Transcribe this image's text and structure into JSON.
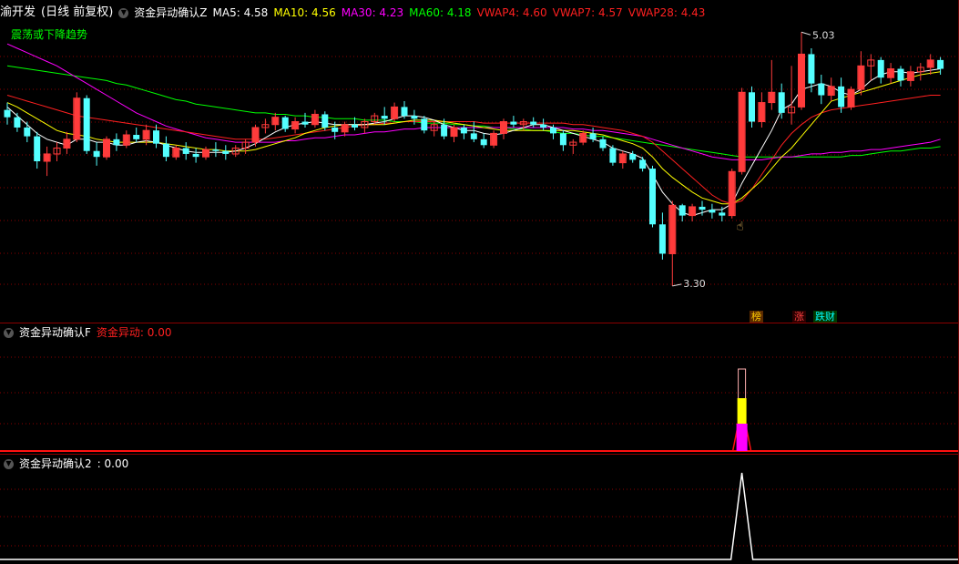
{
  "header": {
    "stock_name": "渝开发",
    "period": "(日线 前复权)",
    "indicator_main": "资金异动确认Z",
    "ma": [
      {
        "label": "MA5: 4.58",
        "color": "#ffffff"
      },
      {
        "label": "MA10: 4.56",
        "color": "#ffff00"
      },
      {
        "label": "MA30: 4.23",
        "color": "#ff00ff"
      },
      {
        "label": "MA60: 4.18",
        "color": "#00ff00"
      },
      {
        "label": "VWAP4: 4.60",
        "color": "#ff2020"
      },
      {
        "label": "VWAP7: 4.57",
        "color": "#ff2020"
      },
      {
        "label": "VWAP28: 4.43",
        "color": "#ff2020"
      }
    ],
    "trend_text": "震荡或下降趋势",
    "high_label": "5.03",
    "low_label": "3.30"
  },
  "badges": [
    {
      "text": "榜",
      "color": "#ffcc00",
      "bg": "#5a2a00"
    },
    {
      "text": "涨",
      "color": "#ff4040",
      "bg": "#2a0000"
    },
    {
      "text": "跌财",
      "color": "#00ffff",
      "bg": "#003a00"
    }
  ],
  "panel2": {
    "title": "资金异动确认F",
    "value_text": "资金异动: 0.00"
  },
  "panel3": {
    "title": "资金异动确认2",
    "value_text": ": 0.00"
  },
  "colors": {
    "up": "#ff3b3b",
    "down": "#54ffff",
    "ma5": "#ffffff",
    "ma10": "#ffff00",
    "ma30": "#ff00ff",
    "ma60": "#00ff00",
    "vwap": "#ff2020",
    "grid": "#8a0000"
  },
  "chart_data": {
    "type": "candlestick",
    "y_range": [
      3.2,
      5.1
    ],
    "candles": [
      [
        4.5,
        4.55,
        4.4,
        4.45
      ],
      [
        4.45,
        4.48,
        4.35,
        4.38
      ],
      [
        4.38,
        4.42,
        4.28,
        4.32
      ],
      [
        4.32,
        4.35,
        4.1,
        4.15
      ],
      [
        4.15,
        4.25,
        4.05,
        4.2
      ],
      [
        4.2,
        4.28,
        4.15,
        4.24
      ],
      [
        4.24,
        4.35,
        4.2,
        4.3
      ],
      [
        4.3,
        4.62,
        4.28,
        4.58
      ],
      [
        4.58,
        4.6,
        4.2,
        4.22
      ],
      [
        4.22,
        4.28,
        4.12,
        4.18
      ],
      [
        4.18,
        4.32,
        4.16,
        4.3
      ],
      [
        4.3,
        4.34,
        4.22,
        4.26
      ],
      [
        4.26,
        4.36,
        4.24,
        4.33
      ],
      [
        4.33,
        4.38,
        4.28,
        4.3
      ],
      [
        4.3,
        4.4,
        4.26,
        4.36
      ],
      [
        4.36,
        4.4,
        4.24,
        4.27
      ],
      [
        4.27,
        4.32,
        4.15,
        4.18
      ],
      [
        4.18,
        4.26,
        4.16,
        4.24
      ],
      [
        4.24,
        4.28,
        4.16,
        4.2
      ],
      [
        4.2,
        4.24,
        4.14,
        4.18
      ],
      [
        4.18,
        4.25,
        4.16,
        4.23
      ],
      [
        4.23,
        4.28,
        4.18,
        4.22
      ],
      [
        4.22,
        4.26,
        4.16,
        4.2
      ],
      [
        4.2,
        4.26,
        4.18,
        4.24
      ],
      [
        4.24,
        4.3,
        4.2,
        4.28
      ],
      [
        4.28,
        4.4,
        4.25,
        4.38
      ],
      [
        4.38,
        4.44,
        4.34,
        4.4
      ],
      [
        4.4,
        4.48,
        4.36,
        4.45
      ],
      [
        4.45,
        4.46,
        4.35,
        4.37
      ],
      [
        4.37,
        4.45,
        4.34,
        4.42
      ],
      [
        4.42,
        4.48,
        4.38,
        4.4
      ],
      [
        4.4,
        4.5,
        4.38,
        4.47
      ],
      [
        4.47,
        4.49,
        4.36,
        4.38
      ],
      [
        4.38,
        4.42,
        4.3,
        4.35
      ],
      [
        4.35,
        4.42,
        4.32,
        4.4
      ],
      [
        4.4,
        4.45,
        4.36,
        4.38
      ],
      [
        4.38,
        4.44,
        4.34,
        4.42
      ],
      [
        4.42,
        4.48,
        4.4,
        4.46
      ],
      [
        4.46,
        4.52,
        4.4,
        4.44
      ],
      [
        4.44,
        4.55,
        4.42,
        4.52
      ],
      [
        4.52,
        4.56,
        4.44,
        4.46
      ],
      [
        4.46,
        4.5,
        4.4,
        4.44
      ],
      [
        4.44,
        4.46,
        4.34,
        4.36
      ],
      [
        4.36,
        4.42,
        4.32,
        4.4
      ],
      [
        4.4,
        4.44,
        4.3,
        4.32
      ],
      [
        4.32,
        4.4,
        4.28,
        4.38
      ],
      [
        4.38,
        4.4,
        4.3,
        4.34
      ],
      [
        4.34,
        4.42,
        4.28,
        4.3
      ],
      [
        4.3,
        4.34,
        4.24,
        4.26
      ],
      [
        4.26,
        4.36,
        4.24,
        4.34
      ],
      [
        4.34,
        4.44,
        4.3,
        4.42
      ],
      [
        4.42,
        4.46,
        4.38,
        4.4
      ],
      [
        4.4,
        4.44,
        4.36,
        4.42
      ],
      [
        4.42,
        4.45,
        4.38,
        4.4
      ],
      [
        4.4,
        4.44,
        4.36,
        4.38
      ],
      [
        4.38,
        4.4,
        4.3,
        4.34
      ],
      [
        4.34,
        4.36,
        4.22,
        4.26
      ],
      [
        4.26,
        4.3,
        4.2,
        4.28
      ],
      [
        4.28,
        4.36,
        4.26,
        4.34
      ],
      [
        4.34,
        4.38,
        4.28,
        4.3
      ],
      [
        4.3,
        4.32,
        4.22,
        4.24
      ],
      [
        4.24,
        4.26,
        4.12,
        4.14
      ],
      [
        4.14,
        4.22,
        4.1,
        4.2
      ],
      [
        4.2,
        4.22,
        4.14,
        4.16
      ],
      [
        4.16,
        4.18,
        4.08,
        4.1
      ],
      [
        4.1,
        4.12,
        3.7,
        3.72
      ],
      [
        3.72,
        3.8,
        3.48,
        3.52
      ],
      [
        3.52,
        3.88,
        3.3,
        3.85
      ],
      [
        3.85,
        3.86,
        3.74,
        3.78
      ],
      [
        3.78,
        3.86,
        3.74,
        3.84
      ],
      [
        3.84,
        3.88,
        3.78,
        3.82
      ],
      [
        3.82,
        3.86,
        3.76,
        3.8
      ],
      [
        3.8,
        3.84,
        3.74,
        3.78
      ],
      [
        3.78,
        4.1,
        3.76,
        4.08
      ],
      [
        4.08,
        4.65,
        4.06,
        4.62
      ],
      [
        4.62,
        4.66,
        4.38,
        4.42
      ],
      [
        4.42,
        4.62,
        4.38,
        4.55
      ],
      [
        4.55,
        4.84,
        4.5,
        4.62
      ],
      [
        4.62,
        4.68,
        4.44,
        4.48
      ],
      [
        4.48,
        4.8,
        4.4,
        4.52
      ],
      [
        4.52,
        5.03,
        4.5,
        4.88
      ],
      [
        4.88,
        4.92,
        4.62,
        4.68
      ],
      [
        4.68,
        4.74,
        4.54,
        4.6
      ],
      [
        4.6,
        4.72,
        4.56,
        4.66
      ],
      [
        4.66,
        4.72,
        4.48,
        4.52
      ],
      [
        4.52,
        4.66,
        4.5,
        4.64
      ],
      [
        4.64,
        4.9,
        4.6,
        4.8
      ],
      [
        4.8,
        4.88,
        4.7,
        4.84
      ],
      [
        4.84,
        4.86,
        4.68,
        4.72
      ],
      [
        4.72,
        4.82,
        4.68,
        4.78
      ],
      [
        4.78,
        4.8,
        4.66,
        4.7
      ],
      [
        4.7,
        4.8,
        4.66,
        4.76
      ],
      [
        4.76,
        4.82,
        4.7,
        4.79
      ],
      [
        4.79,
        4.88,
        4.74,
        4.84
      ],
      [
        4.84,
        4.86,
        4.74,
        4.78
      ]
    ],
    "ma5": [
      4.52,
      4.46,
      4.4,
      4.34,
      4.3,
      4.28,
      4.26,
      4.3,
      4.3,
      4.28,
      4.28,
      4.26,
      4.26,
      4.28,
      4.29,
      4.28,
      4.26,
      4.24,
      4.22,
      4.21,
      4.21,
      4.21,
      4.21,
      4.22,
      4.24,
      4.27,
      4.31,
      4.35,
      4.38,
      4.4,
      4.41,
      4.42,
      4.41,
      4.4,
      4.4,
      4.4,
      4.4,
      4.41,
      4.42,
      4.44,
      4.46,
      4.46,
      4.45,
      4.43,
      4.4,
      4.38,
      4.36,
      4.36,
      4.34,
      4.33,
      4.34,
      4.36,
      4.38,
      4.4,
      4.4,
      4.38,
      4.36,
      4.34,
      4.32,
      4.3,
      4.28,
      4.24,
      4.22,
      4.2,
      4.17,
      4.06,
      3.94,
      3.86,
      3.8,
      3.78,
      3.8,
      3.82,
      3.82,
      3.86,
      4.0,
      4.12,
      4.24,
      4.36,
      4.5,
      4.54,
      4.64,
      4.66,
      4.68,
      4.66,
      4.62,
      4.6,
      4.64,
      4.7,
      4.74,
      4.76,
      4.76,
      4.75,
      4.76,
      4.77,
      4.78
    ],
    "ma10": [
      4.55,
      4.52,
      4.48,
      4.44,
      4.4,
      4.36,
      4.34,
      4.33,
      4.32,
      4.3,
      4.29,
      4.28,
      4.28,
      4.28,
      4.28,
      4.28,
      4.27,
      4.26,
      4.25,
      4.24,
      4.23,
      4.23,
      4.22,
      4.22,
      4.22,
      4.23,
      4.25,
      4.27,
      4.29,
      4.31,
      4.34,
      4.36,
      4.38,
      4.39,
      4.4,
      4.4,
      4.4,
      4.4,
      4.4,
      4.41,
      4.42,
      4.43,
      4.43,
      4.43,
      4.42,
      4.41,
      4.4,
      4.39,
      4.38,
      4.37,
      4.36,
      4.36,
      4.36,
      4.36,
      4.36,
      4.36,
      4.36,
      4.36,
      4.35,
      4.34,
      4.33,
      4.31,
      4.29,
      4.27,
      4.24,
      4.18,
      4.1,
      4.04,
      3.99,
      3.94,
      3.9,
      3.88,
      3.86,
      3.86,
      3.9,
      3.96,
      4.02,
      4.1,
      4.18,
      4.24,
      4.32,
      4.4,
      4.48,
      4.56,
      4.58,
      4.6,
      4.62,
      4.64,
      4.66,
      4.68,
      4.7,
      4.72,
      4.74,
      4.75,
      4.76
    ],
    "ma30": [
      4.95,
      4.92,
      4.89,
      4.86,
      4.83,
      4.8,
      4.76,
      4.72,
      4.68,
      4.64,
      4.6,
      4.56,
      4.52,
      4.48,
      4.45,
      4.42,
      4.39,
      4.37,
      4.35,
      4.33,
      4.31,
      4.3,
      4.29,
      4.28,
      4.28,
      4.28,
      4.28,
      4.28,
      4.29,
      4.29,
      4.3,
      4.31,
      4.31,
      4.32,
      4.33,
      4.33,
      4.34,
      4.35,
      4.35,
      4.36,
      4.37,
      4.37,
      4.38,
      4.38,
      4.38,
      4.38,
      4.38,
      4.38,
      4.38,
      4.38,
      4.38,
      4.38,
      4.38,
      4.38,
      4.38,
      4.38,
      4.38,
      4.37,
      4.37,
      4.36,
      4.36,
      4.35,
      4.34,
      4.33,
      4.32,
      4.3,
      4.28,
      4.26,
      4.24,
      4.22,
      4.2,
      4.18,
      4.17,
      4.16,
      4.16,
      4.16,
      4.16,
      4.17,
      4.18,
      4.18,
      4.19,
      4.2,
      4.2,
      4.21,
      4.21,
      4.22,
      4.22,
      4.23,
      4.23,
      4.24,
      4.25,
      4.26,
      4.27,
      4.28,
      4.3
    ],
    "ma60": [
      4.8,
      4.79,
      4.78,
      4.77,
      4.76,
      4.75,
      4.74,
      4.73,
      4.72,
      4.71,
      4.7,
      4.68,
      4.67,
      4.65,
      4.63,
      4.61,
      4.59,
      4.57,
      4.56,
      4.54,
      4.53,
      4.52,
      4.51,
      4.5,
      4.49,
      4.48,
      4.48,
      4.47,
      4.47,
      4.46,
      4.46,
      4.45,
      4.45,
      4.44,
      4.44,
      4.44,
      4.43,
      4.43,
      4.43,
      4.42,
      4.42,
      4.42,
      4.41,
      4.41,
      4.41,
      4.4,
      4.4,
      4.39,
      4.39,
      4.38,
      4.38,
      4.37,
      4.37,
      4.36,
      4.36,
      4.35,
      4.34,
      4.34,
      4.33,
      4.32,
      4.32,
      4.31,
      4.3,
      4.29,
      4.28,
      4.27,
      4.26,
      4.25,
      4.24,
      4.23,
      4.22,
      4.21,
      4.2,
      4.19,
      4.18,
      4.18,
      4.18,
      4.18,
      4.18,
      4.18,
      4.18,
      4.18,
      4.18,
      4.18,
      4.18,
      4.19,
      4.19,
      4.2,
      4.21,
      4.22,
      4.22,
      4.23,
      4.24,
      4.24,
      4.25
    ],
    "vwap28": [
      4.6,
      4.58,
      4.56,
      4.54,
      4.52,
      4.5,
      4.48,
      4.46,
      4.45,
      4.44,
      4.43,
      4.42,
      4.41,
      4.4,
      4.39,
      4.38,
      4.37,
      4.36,
      4.35,
      4.34,
      4.33,
      4.32,
      4.31,
      4.3,
      4.3,
      4.3,
      4.3,
      4.31,
      4.32,
      4.33,
      4.34,
      4.35,
      4.36,
      4.37,
      4.38,
      4.39,
      4.4,
      4.4,
      4.41,
      4.41,
      4.42,
      4.42,
      4.42,
      4.42,
      4.42,
      4.42,
      4.42,
      4.42,
      4.41,
      4.41,
      4.41,
      4.41,
      4.41,
      4.41,
      4.41,
      4.41,
      4.41,
      4.4,
      4.4,
      4.39,
      4.38,
      4.37,
      4.36,
      4.34,
      4.32,
      4.28,
      4.22,
      4.16,
      4.1,
      4.04,
      3.98,
      3.92,
      3.88,
      3.86,
      3.88,
      3.96,
      4.06,
      4.16,
      4.26,
      4.34,
      4.4,
      4.45,
      4.48,
      4.5,
      4.51,
      4.52,
      4.53,
      4.54,
      4.55,
      4.56,
      4.57,
      4.58,
      4.59,
      4.6,
      4.6
    ],
    "signal_index": 74
  }
}
